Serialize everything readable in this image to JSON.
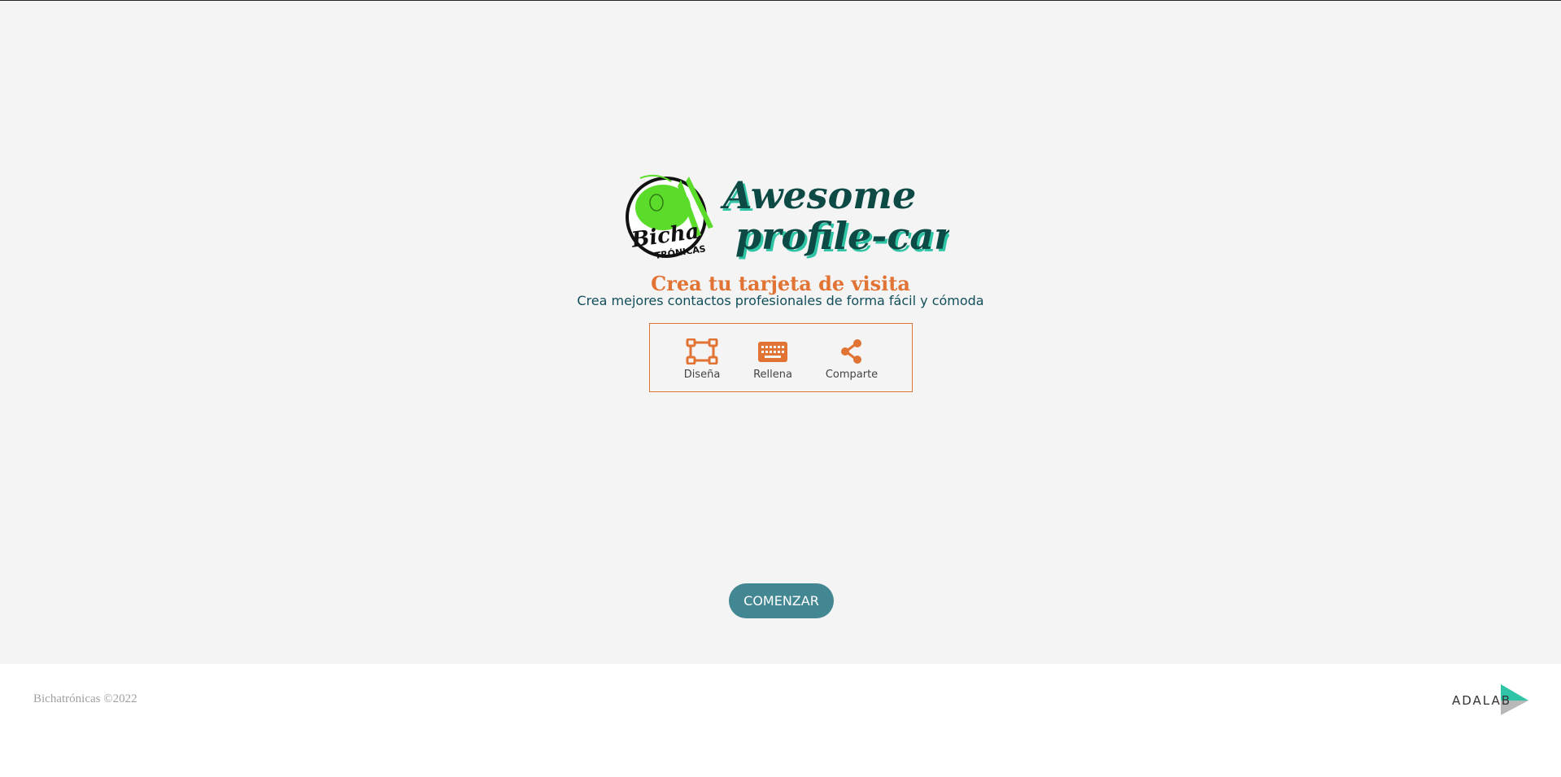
{
  "brand": {
    "logo_text_line1": "Awesome",
    "logo_text_line2": "profile-cards",
    "logo_badge_text1": "Bicha",
    "logo_badge_text2": "TRÓNICAS",
    "colors": {
      "accent": "#e17334",
      "primary": "#438792",
      "dark": "#114e5a",
      "logo_green": "#5bdc2b",
      "background": "#f4f4f4"
    }
  },
  "hero": {
    "title": "Crea tu tarjeta de visita",
    "tagline": "Crea mejores contactos profesionales de forma fácil y cómoda",
    "steps": [
      {
        "label": "Diseña",
        "icon": "vector-square-icon"
      },
      {
        "label": "Rellena",
        "icon": "keyboard-icon"
      },
      {
        "label": "Comparte",
        "icon": "share-icon"
      }
    ],
    "start_button": "COMENZAR"
  },
  "footer": {
    "copyright": "Bichatrónicas ©2022",
    "partner_logo_text": "ADALAB"
  }
}
